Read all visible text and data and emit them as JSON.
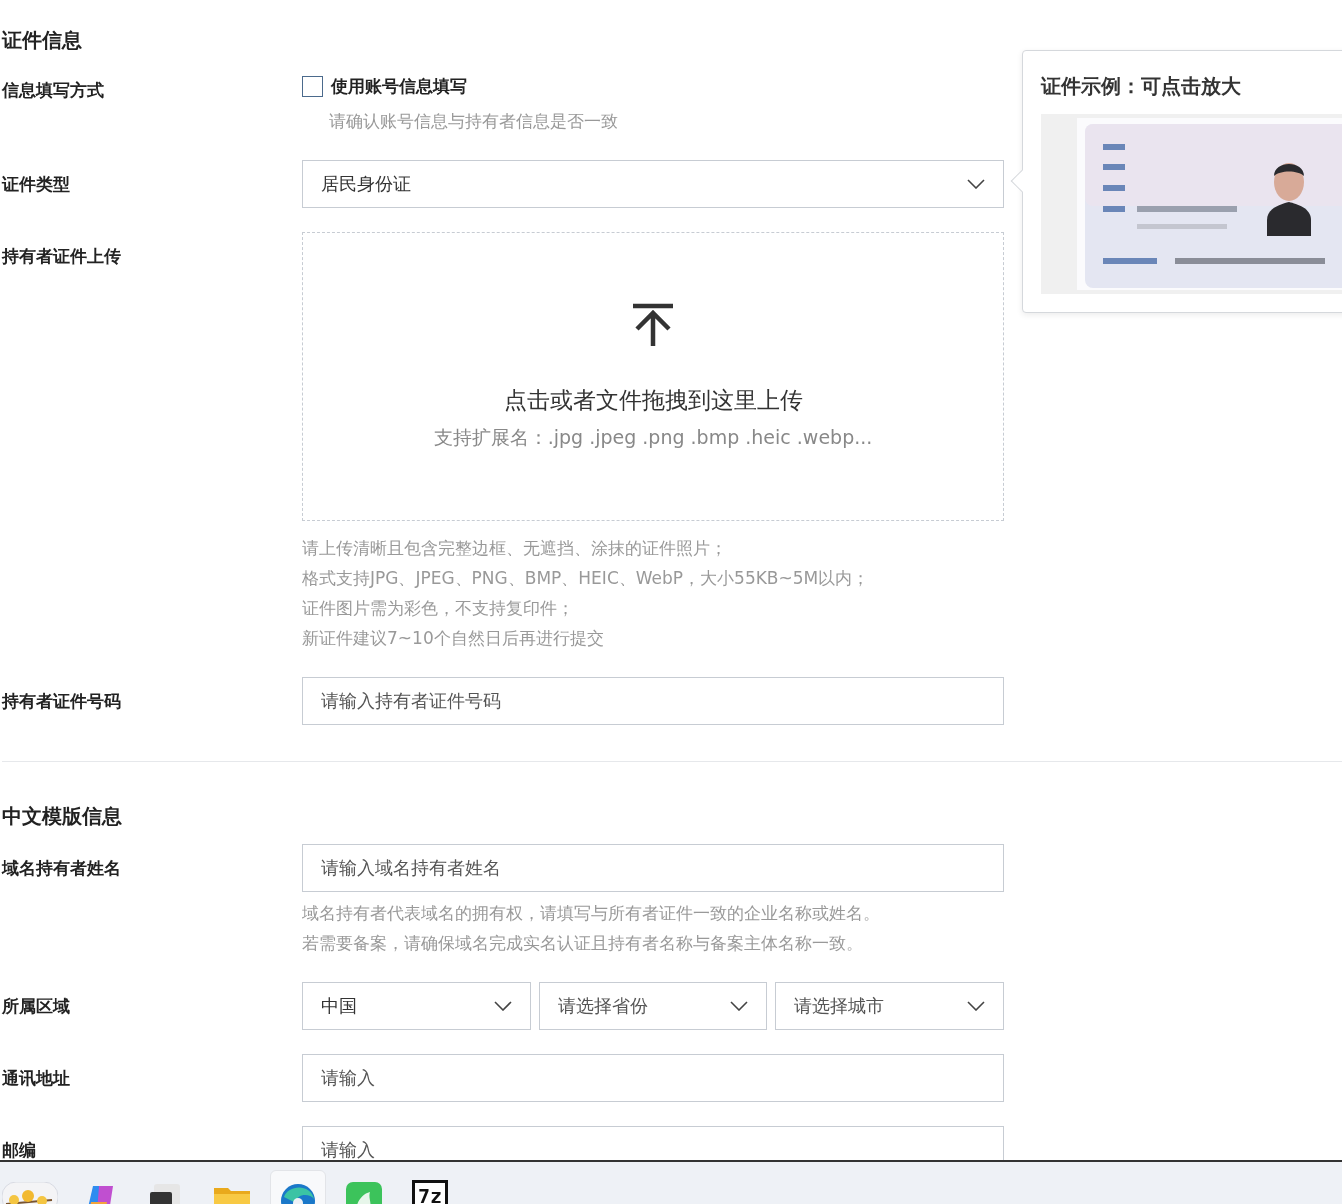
{
  "sections": [
    {
      "title": "证件信息",
      "fields": [
        {
          "kind": "checkbox",
          "label": "信息填写方式",
          "option": "使用账号信息填写",
          "checked": false,
          "hints": [
            "请确认账号信息与持有者信息是否一致"
          ]
        },
        {
          "kind": "select",
          "label": "证件类型",
          "value": "居民身份证"
        },
        {
          "kind": "upload",
          "label": "持有者证件上传",
          "title": "点击或者文件拖拽到这里上传",
          "subtitle": "支持扩展名：.jpg .jpeg .png .bmp .heic .webp...",
          "hints": [
            "请上传清晰且包含完整边框、无遮挡、涂抹的证件照片；",
            "格式支持JPG、JPEG、PNG、BMP、HEIC、WebP，大小55KB~5M以内；",
            "证件图片需为彩色，不支持复印件；",
            "新证件建议7~10个自然日后再进行提交"
          ]
        },
        {
          "kind": "input",
          "label": "持有者证件号码",
          "placeholder": "请输入持有者证件号码"
        }
      ]
    },
    {
      "title": "中文模版信息",
      "fields": [
        {
          "kind": "input",
          "label": "域名持有者姓名",
          "placeholder": "请输入域名持有者姓名",
          "hints": [
            "域名持有者代表域名的拥有权，请填写与所有者证件一致的企业名称或姓名。",
            "若需要备案，请确保域名完成实名认证且持有者名称与备案主体名称一致。"
          ]
        },
        {
          "kind": "region",
          "label": "所属区域",
          "selects": [
            {
              "value": "中国"
            },
            {
              "placeholder": "请选择省份"
            },
            {
              "placeholder": "请选择城市"
            }
          ]
        },
        {
          "kind": "input",
          "label": "通讯地址",
          "placeholder": "请输入"
        },
        {
          "kind": "input",
          "label": "邮编",
          "placeholder": "请输入"
        }
      ]
    }
  ],
  "popover": {
    "title": "证件示例：可点击放大"
  },
  "taskbar": [
    {
      "kind": "widget",
      "selected": false
    },
    {
      "kind": "copilot",
      "selected": false
    },
    {
      "kind": "terminal",
      "selected": false
    },
    {
      "kind": "folder",
      "selected": false
    },
    {
      "kind": "browser",
      "selected": true
    },
    {
      "kind": "green-app",
      "selected": false
    },
    {
      "kind": "archiver",
      "label": "7z",
      "selected": false
    }
  ]
}
